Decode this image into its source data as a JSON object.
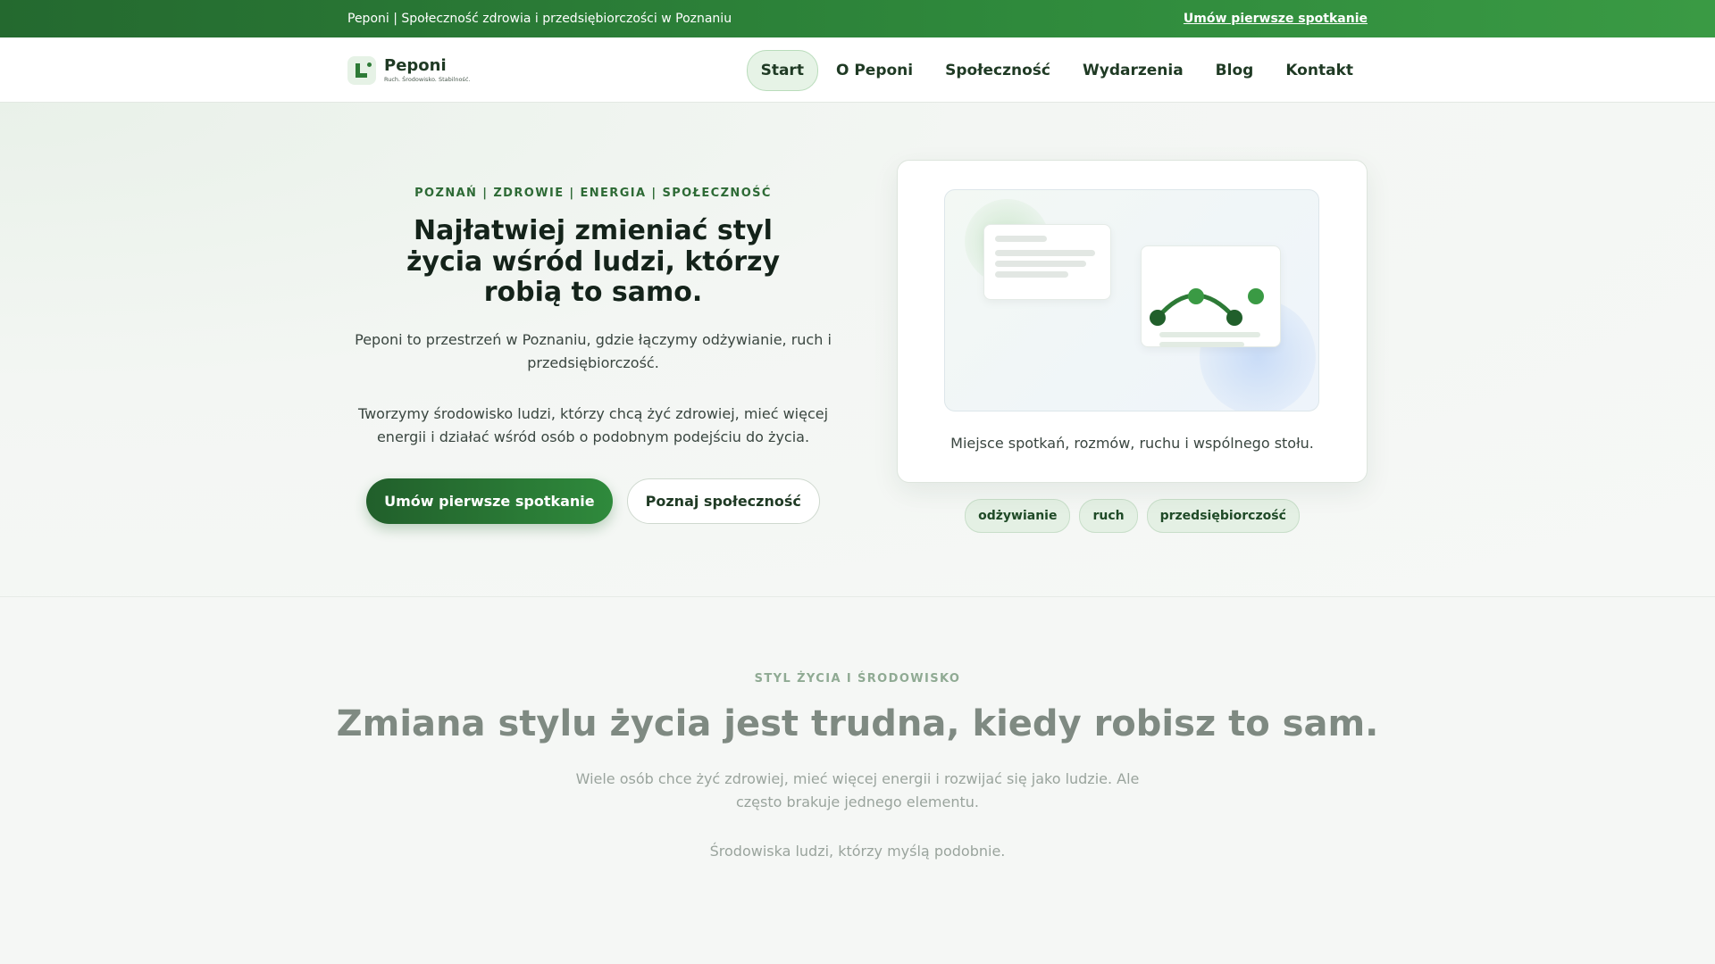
{
  "topbar": {
    "text": "Peponi | Społeczność zdrowia i przedsiębiorczości w Poznaniu",
    "cta": "Umów pierwsze spotkanie"
  },
  "header": {
    "brand_name": "Peponi",
    "brand_tagline": "Ruch. Środowisko. Stabilność.",
    "logo_icon": "peponi-logo-icon",
    "nav": [
      {
        "label": "Start",
        "active": true
      },
      {
        "label": "O Peponi",
        "active": false
      },
      {
        "label": "Społeczność",
        "active": false
      },
      {
        "label": "Wydarzenia",
        "active": false
      },
      {
        "label": "Blog",
        "active": false
      },
      {
        "label": "Kontakt",
        "active": false
      }
    ]
  },
  "hero": {
    "eyebrow": "POZNAŃ | ZDROWIE | ENERGIA | SPOŁECZNOŚĆ",
    "title": "Najłatwiej zmieniać styl życia wśród ludzi, którzy robią to samo.",
    "paragraph1": "Peponi to przestrzeń w Poznaniu, gdzie łączymy odżywianie, ruch i przedsiębiorczość.",
    "paragraph2": "Tworzymy środowisko ludzi, którzy chcą żyć zdrowiej, mieć więcej energii i działać wśród osób o podobnym podejściu do życia.",
    "primary_button": "Umów pierwsze spotkanie",
    "secondary_button": "Poznaj społeczność",
    "card_caption": "Miejsce spotkań, rozmów, ruchu i wspólnego stołu.",
    "tags": [
      "odżywianie",
      "ruch",
      "przedsiębiorczość"
    ]
  },
  "section2": {
    "eyebrow": "STYL ŻYCIA I ŚRODOWISKO",
    "title": "Zmiana stylu życia jest trudna, kiedy robisz to sam.",
    "paragraph1": "Wiele osób chce żyć zdrowiej, mieć więcej energii i rozwijać się jako ludzie. Ale często brakuje jednego elementu.",
    "paragraph2": "Środowiska ludzi, którzy myślą podobnie."
  },
  "colors": {
    "brand_green": "#2d7a36",
    "dark_green": "#215f2b",
    "accent_green": "#3a9a44"
  }
}
